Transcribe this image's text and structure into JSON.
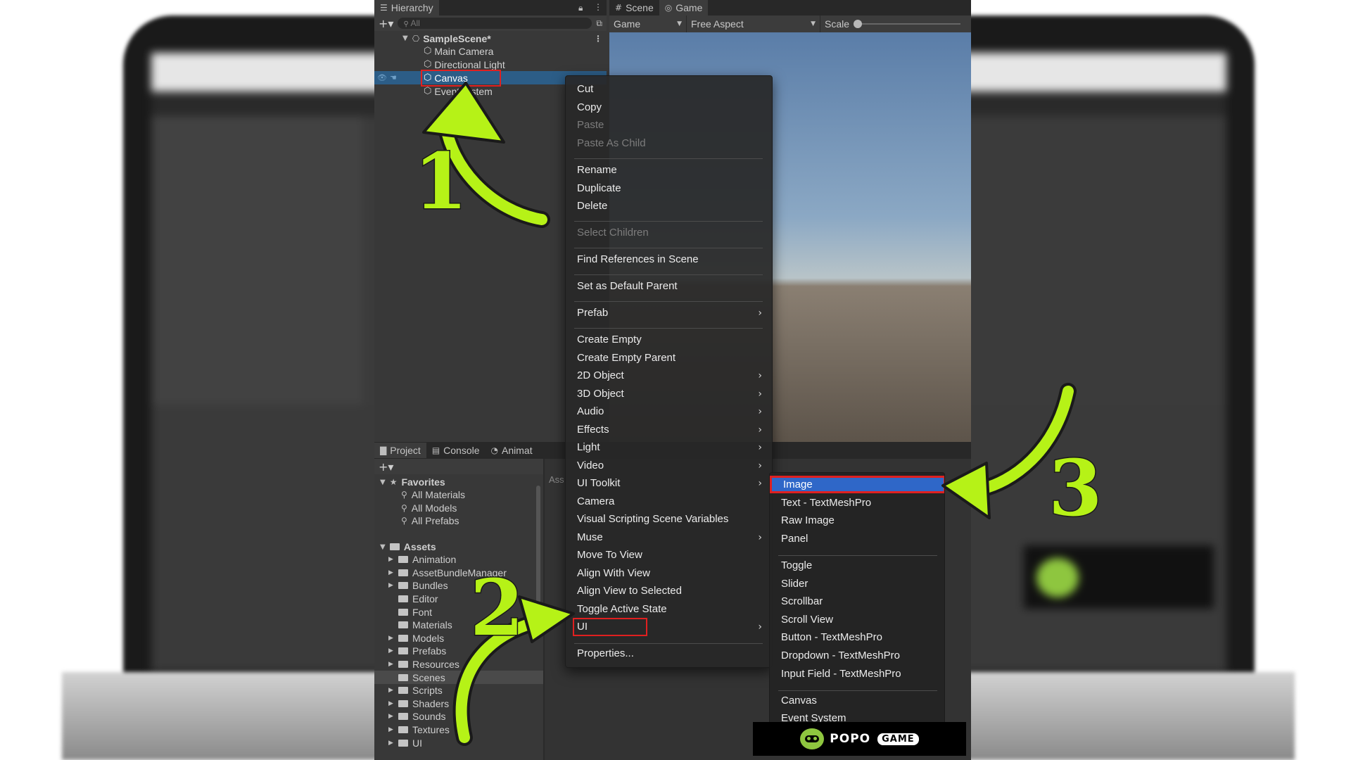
{
  "hierarchy": {
    "title": "Hierarchy",
    "search_placeholder": "All",
    "scene": "SampleScene*",
    "items": [
      {
        "label": "Main Camera"
      },
      {
        "label": "Directional Light"
      },
      {
        "label": "Canvas",
        "selected": true
      },
      {
        "label": "EventSystem"
      }
    ]
  },
  "scene_tab": {
    "label": "Scene"
  },
  "game_tab": {
    "label": "Game"
  },
  "game_toolbar": {
    "display": "Game",
    "aspect": "Free Aspect",
    "scale_label": "Scale"
  },
  "project": {
    "tabs": [
      {
        "label": "Project"
      },
      {
        "label": "Console"
      },
      {
        "label": "Animat"
      }
    ],
    "right_label": "Ass",
    "favorites": {
      "label": "Favorites",
      "items": [
        "All Materials",
        "All Models",
        "All Prefabs"
      ]
    },
    "assets": {
      "label": "Assets",
      "items": [
        "Animation",
        "AssetBundleManager",
        "Bundles",
        "Editor",
        "Font",
        "Materials",
        "Models",
        "Prefabs",
        "Resources",
        "Scenes",
        "Scripts",
        "Shaders",
        "Sounds",
        "Textures",
        "UI"
      ],
      "selected": "Scenes"
    }
  },
  "context_menu": {
    "items": [
      {
        "label": "Cut"
      },
      {
        "label": "Copy"
      },
      {
        "label": "Paste",
        "disabled": true
      },
      {
        "label": "Paste As Child",
        "disabled": true
      },
      {
        "label": "Rename"
      },
      {
        "label": "Duplicate"
      },
      {
        "label": "Delete"
      },
      {
        "label": "Select Children",
        "disabled": true
      },
      {
        "label": "Find References in Scene"
      },
      {
        "label": "Set as Default Parent"
      },
      {
        "label": "Prefab",
        "submenu": true
      },
      {
        "label": "Create Empty"
      },
      {
        "label": "Create Empty Parent"
      },
      {
        "label": "2D Object",
        "submenu": true
      },
      {
        "label": "3D Object",
        "submenu": true
      },
      {
        "label": "Audio",
        "submenu": true
      },
      {
        "label": "Effects",
        "submenu": true
      },
      {
        "label": "Light",
        "submenu": true
      },
      {
        "label": "Video",
        "submenu": true
      },
      {
        "label": "UI Toolkit",
        "submenu": true
      },
      {
        "label": "Camera"
      },
      {
        "label": "Visual Scripting Scene Variables"
      },
      {
        "label": "Muse",
        "submenu": true
      },
      {
        "label": "Move To View"
      },
      {
        "label": "Align With View"
      },
      {
        "label": "Align View to Selected"
      },
      {
        "label": "Toggle Active State"
      },
      {
        "label": "UI",
        "submenu": true,
        "highlighted": true
      },
      {
        "label": "Properties..."
      }
    ]
  },
  "ui_submenu": {
    "items": [
      {
        "label": "Image",
        "selected": true
      },
      {
        "label": "Text - TextMeshPro"
      },
      {
        "label": "Raw Image"
      },
      {
        "label": "Panel"
      },
      {
        "label": "Toggle"
      },
      {
        "label": "Slider"
      },
      {
        "label": "Scrollbar"
      },
      {
        "label": "Scroll View"
      },
      {
        "label": "Button - TextMeshPro"
      },
      {
        "label": "Dropdown - TextMeshPro"
      },
      {
        "label": "Input Field - TextMeshPro"
      },
      {
        "label": "Canvas"
      },
      {
        "label": "Event System"
      }
    ]
  },
  "annotations": {
    "step1": "1",
    "step2": "2",
    "step3": "3",
    "arrow_color": "#b6f217",
    "highlight_color": "#e02020"
  },
  "brand": {
    "name": "POPO",
    "pill": "GAME"
  }
}
